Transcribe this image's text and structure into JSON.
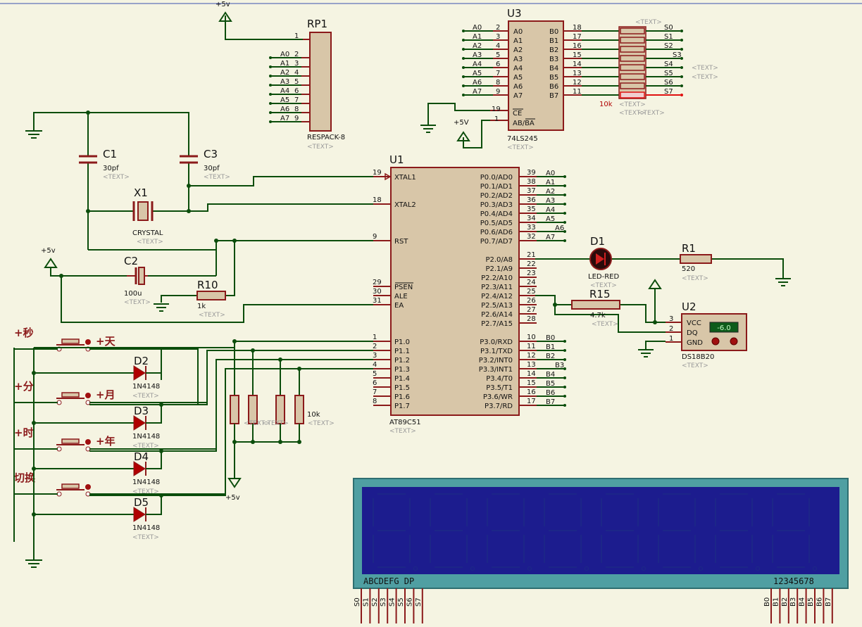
{
  "power": {
    "vcc": "+5v",
    "vcc_upper": "+5V"
  },
  "rp1": {
    "ref": "RP1",
    "part": "RESPACK-8",
    "text": "<TEXT>",
    "pin1": "1",
    "pins": [
      {
        "name": "A0",
        "num": "2"
      },
      {
        "name": "A1",
        "num": "3"
      },
      {
        "name": "A2",
        "num": "4"
      },
      {
        "name": "A3",
        "num": "5"
      },
      {
        "name": "A4",
        "num": "6"
      },
      {
        "name": "A5",
        "num": "7"
      },
      {
        "name": "A6",
        "num": "8"
      },
      {
        "name": "A7",
        "num": "9"
      }
    ]
  },
  "u3": {
    "ref": "U3",
    "part": "74LS245",
    "text": "<TEXT>",
    "left": [
      {
        "net": "A0",
        "num": "2",
        "pin": "A0"
      },
      {
        "net": "A1",
        "num": "3",
        "pin": "A1"
      },
      {
        "net": "A2",
        "num": "4",
        "pin": "A2"
      },
      {
        "net": "A3",
        "num": "5",
        "pin": "A3"
      },
      {
        "net": "A4",
        "num": "6",
        "pin": "A4"
      },
      {
        "net": "A5",
        "num": "7",
        "pin": "A5"
      },
      {
        "net": "A6",
        "num": "8",
        "pin": "A6"
      },
      {
        "net": "A7",
        "num": "9",
        "pin": "A7"
      }
    ],
    "right": [
      {
        "pin": "B0",
        "num": "18"
      },
      {
        "pin": "B1",
        "num": "17"
      },
      {
        "pin": "B2",
        "num": "16"
      },
      {
        "pin": "B3",
        "num": "15"
      },
      {
        "pin": "B4",
        "num": "14"
      },
      {
        "pin": "B5",
        "num": "13"
      },
      {
        "pin": "B6",
        "num": "12"
      },
      {
        "pin": "B7",
        "num": "11"
      }
    ],
    "ce": {
      "pin": "CE",
      "num": "19"
    },
    "abba": {
      "pin": "AB/BA",
      "num": "1"
    }
  },
  "rnet": {
    "value": "10k",
    "text": "<TEXT>",
    "outs": [
      "S0",
      "S1",
      "S2",
      "S3",
      "S4",
      "S5",
      "S6",
      "S7"
    ]
  },
  "u1": {
    "ref": "U1",
    "part": "AT89C51",
    "text": "<TEXT>",
    "left": [
      {
        "pin": "XTAL1",
        "num": "19"
      },
      {
        "pin": "XTAL2",
        "num": "18"
      },
      {
        "pin": "RST",
        "num": "9"
      },
      {
        "pin": "PSEN",
        "num": "29"
      },
      {
        "pin": "ALE",
        "num": "30"
      },
      {
        "pin": "EA",
        "num": "31"
      },
      {
        "pin": "P1.0",
        "num": "1"
      },
      {
        "pin": "P1.1",
        "num": "2"
      },
      {
        "pin": "P1.2",
        "num": "3"
      },
      {
        "pin": "P1.3",
        "num": "4"
      },
      {
        "pin": "P1.4",
        "num": "5"
      },
      {
        "pin": "P1.5",
        "num": "6"
      },
      {
        "pin": "P1.6",
        "num": "7"
      },
      {
        "pin": "P1.7",
        "num": "8"
      }
    ],
    "right": [
      {
        "pin": "P0.0/AD0",
        "num": "39",
        "net": "A0"
      },
      {
        "pin": "P0.1/AD1",
        "num": "38",
        "net": "A1"
      },
      {
        "pin": "P0.2/AD2",
        "num": "37",
        "net": "A2"
      },
      {
        "pin": "P0.3/AD3",
        "num": "36",
        "net": "A3"
      },
      {
        "pin": "P0.4/AD4",
        "num": "35",
        "net": "A4"
      },
      {
        "pin": "P0.5/AD5",
        "num": "34",
        "net": "A5"
      },
      {
        "pin": "P0.6/AD6",
        "num": "33",
        "net": "A6"
      },
      {
        "pin": "P0.7/AD7",
        "num": "32",
        "net": "A7"
      },
      {
        "pin": "P2.0/A8",
        "num": "21",
        "net": ""
      },
      {
        "pin": "P2.1/A9",
        "num": "22",
        "net": ""
      },
      {
        "pin": "P2.2/A10",
        "num": "23",
        "net": ""
      },
      {
        "pin": "P2.3/A11",
        "num": "24",
        "net": ""
      },
      {
        "pin": "P2.4/A12",
        "num": "25",
        "net": ""
      },
      {
        "pin": "P2.5/A13",
        "num": "26",
        "net": ""
      },
      {
        "pin": "P2.6/A14",
        "num": "27",
        "net": ""
      },
      {
        "pin": "P2.7/A15",
        "num": "28",
        "net": ""
      },
      {
        "pin": "P3.0/RXD",
        "num": "10",
        "net": "B0"
      },
      {
        "pin": "P3.1/TXD",
        "num": "11",
        "net": "B1"
      },
      {
        "pin": "P3.2/INT0",
        "num": "12",
        "net": "B2"
      },
      {
        "pin": "P3.3/INT1",
        "num": "13",
        "net": "B3"
      },
      {
        "pin": "P3.4/T0",
        "num": "14",
        "net": "B4"
      },
      {
        "pin": "P3.5/T1",
        "num": "15",
        "net": "B5"
      },
      {
        "pin": "P3.6/WR",
        "num": "16",
        "net": "B6"
      },
      {
        "pin": "P3.7/RD",
        "num": "17",
        "net": "B7"
      }
    ]
  },
  "c1": {
    "ref": "C1",
    "value": "30pf",
    "text": "<TEXT>"
  },
  "c3": {
    "ref": "C3",
    "value": "30pf",
    "text": "<TEXT>"
  },
  "x1": {
    "ref": "X1",
    "part": "CRYSTAL",
    "text": "<TEXT>"
  },
  "c2": {
    "ref": "C2",
    "value": "100u",
    "text": "<TEXT>"
  },
  "r10": {
    "ref": "R10",
    "value": "1k",
    "text": "<TEXT>"
  },
  "d1": {
    "ref": "D1",
    "part": "LED-RED",
    "text": "<TEXT>"
  },
  "r1": {
    "ref": "R1",
    "value": "520",
    "text": "<TEXT>"
  },
  "r15": {
    "ref": "R15",
    "value": "4.7k",
    "text": "<TEXT>"
  },
  "u2": {
    "ref": "U2",
    "part": "DS18B20",
    "text": "<TEXT>",
    "reading": "-6.0",
    "pins": [
      {
        "pin": "VCC",
        "num": "3"
      },
      {
        "pin": "DQ",
        "num": "2"
      },
      {
        "pin": "GND",
        "num": "1"
      }
    ]
  },
  "buttons": [
    {
      "left": "+秒",
      "right": "+天"
    },
    {
      "left": "+分",
      "right": "+月"
    },
    {
      "left": "+时",
      "right": "+年"
    },
    {
      "left": "切换",
      "right": ""
    }
  ],
  "diodes": [
    {
      "ref": "D2",
      "part": "1N4148",
      "text": "<TEXT>"
    },
    {
      "ref": "D3",
      "part": "1N4148",
      "text": "<TEXT>"
    },
    {
      "ref": "D4",
      "part": "1N4148",
      "text": "<TEXT>"
    },
    {
      "ref": "D5",
      "part": "1N4148",
      "text": "<TEXT>"
    }
  ],
  "pullups": {
    "value": "10k",
    "text": "<TEXT>"
  },
  "display": {
    "seg_label": "ABCDEFG DP",
    "dig_label": "12345678",
    "seg_pins": [
      "S0",
      "S1",
      "S2",
      "S3",
      "S4",
      "S5",
      "S6",
      "S7"
    ],
    "dig_pins": [
      "B0",
      "B1",
      "B2",
      "B3",
      "B4",
      "B5",
      "B6",
      "B7"
    ]
  },
  "colors": {
    "background": "#f5f4e2",
    "wire": "#0b4d0b",
    "component": "#8b1a1a",
    "chip_fill": "#d8c6a8",
    "lcd_frame": "#4f9fa2",
    "lcd_glass": "#1c1c8e"
  }
}
